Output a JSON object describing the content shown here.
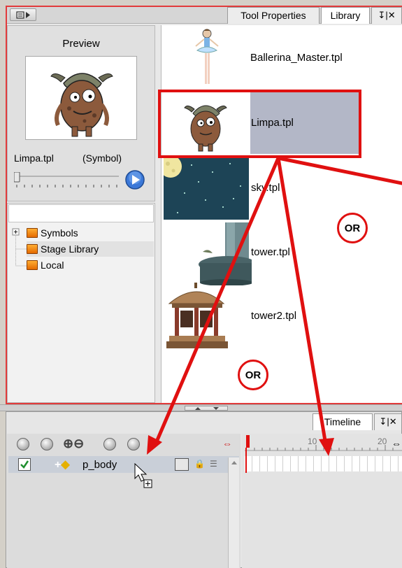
{
  "library": {
    "tabs": [
      "Tool Properties",
      "Library"
    ],
    "preview_label": "Preview",
    "symbol_name": "Limpa.tpl",
    "symbol_type": "(Symbol)",
    "tree": [
      "Symbols",
      "Stage Library",
      "Local"
    ],
    "templates": [
      {
        "name": "Ballerina_Master.tpl"
      },
      {
        "name": "Limpa.tpl",
        "selected": true
      },
      {
        "name": "sky.tpl"
      },
      {
        "name": "tower.tpl"
      },
      {
        "name": "tower2.tpl"
      }
    ],
    "or_labels": [
      "OR",
      "OR"
    ]
  },
  "timeline": {
    "tab": "Timeline",
    "layer_name": "p_body",
    "frame_ticks": [
      "10",
      "20"
    ]
  },
  "colors": {
    "annotation_red": "#e01010",
    "selection": "#b3b7c7",
    "checkbox": "#1f8f2f"
  }
}
